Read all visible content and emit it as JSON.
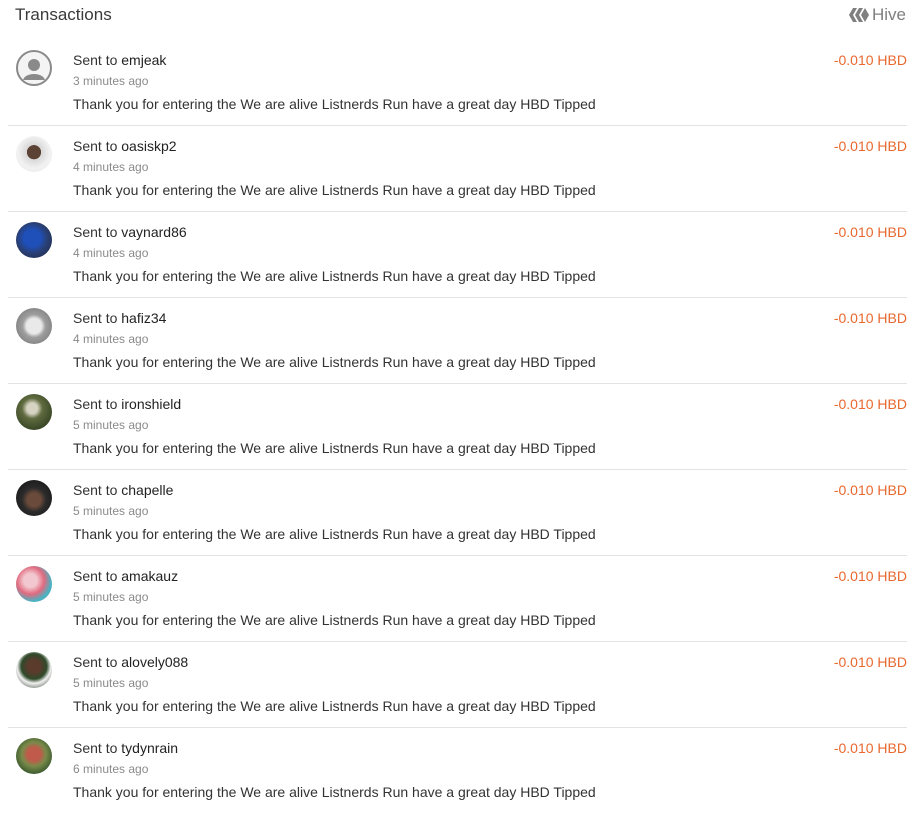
{
  "header": {
    "title": "Transactions",
    "brand": "Hive"
  },
  "transactions": [
    {
      "prefix": "Sent to",
      "user": "emjeak",
      "time": "3 minutes ago",
      "memo": "Thank you for entering the We are alive Listnerds Run have a great day HBD Tipped",
      "amount": "-0.010 HBD",
      "avatar": "default"
    },
    {
      "prefix": "Sent to",
      "user": "oasiskp2",
      "time": "4 minutes ago",
      "memo": "Thank you for entering the We are alive Listnerds Run have a great day HBD Tipped",
      "amount": "-0.010 HBD",
      "avatar": "light-photo"
    },
    {
      "prefix": "Sent to",
      "user": "vaynard86",
      "time": "4 minutes ago",
      "memo": "Thank you for entering the We are alive Listnerds Run have a great day HBD Tipped",
      "amount": "-0.010 HBD",
      "avatar": "blue-photo"
    },
    {
      "prefix": "Sent to",
      "user": "hafiz34",
      "time": "4 minutes ago",
      "memo": "Thank you for entering the We are alive Listnerds Run have a great day HBD Tipped",
      "amount": "-0.010 HBD",
      "avatar": "grey-photo"
    },
    {
      "prefix": "Sent to",
      "user": "ironshield",
      "time": "5 minutes ago",
      "memo": "Thank you for entering the We are alive Listnerds Run have a great day HBD Tipped",
      "amount": "-0.010 HBD",
      "avatar": "green-photo"
    },
    {
      "prefix": "Sent to",
      "user": "chapelle",
      "time": "5 minutes ago",
      "memo": "Thank you for entering the We are alive Listnerds Run have a great day HBD Tipped",
      "amount": "-0.010 HBD",
      "avatar": "dark-photo"
    },
    {
      "prefix": "Sent to",
      "user": "amakauz",
      "time": "5 minutes ago",
      "memo": "Thank you for entering the We are alive Listnerds Run have a great day HBD Tipped",
      "amount": "-0.010 HBD",
      "avatar": "pink-photo"
    },
    {
      "prefix": "Sent to",
      "user": "alovely088",
      "time": "5 minutes ago",
      "memo": "Thank you for entering the We are alive Listnerds Run have a great day HBD Tipped",
      "amount": "-0.010 HBD",
      "avatar": "forest-photo"
    },
    {
      "prefix": "Sent to",
      "user": "tydynrain",
      "time": "6 minutes ago",
      "memo": "Thank you for entering the We are alive Listnerds Run have a great day HBD Tipped",
      "amount": "-0.010 HBD",
      "avatar": "red-green-photo"
    }
  ],
  "colors": {
    "amount": "#e8682f",
    "divider": "#e3e3e3",
    "muted": "#8a8a8a"
  },
  "icons": {
    "brand": "hive-logo-icon",
    "default_avatar": "user-icon"
  }
}
